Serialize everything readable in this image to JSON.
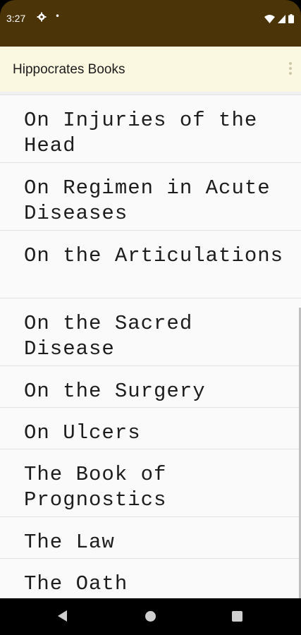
{
  "status": {
    "time": "3:27",
    "dot": "•",
    "icons": [
      "gear-icon",
      "wifi-icon",
      "signal-icon",
      "battery-icon"
    ]
  },
  "appbar": {
    "title": "Hippocrates Books"
  },
  "books": [
    {
      "title": "On Injuries of the Head"
    },
    {
      "title": "On Regimen in Acute Diseases"
    },
    {
      "title": "On the Articulations"
    },
    {
      "title": "On the Sacred Disease"
    },
    {
      "title": "On the Surgery"
    },
    {
      "title": "On Ulcers"
    },
    {
      "title": "The Book of Prognostics"
    },
    {
      "title": "The Law"
    },
    {
      "title": "The Oath"
    }
  ],
  "colors": {
    "statusbar": "#4a3408",
    "appbar": "#fbf8e2",
    "list_bg": "#fafafa"
  }
}
